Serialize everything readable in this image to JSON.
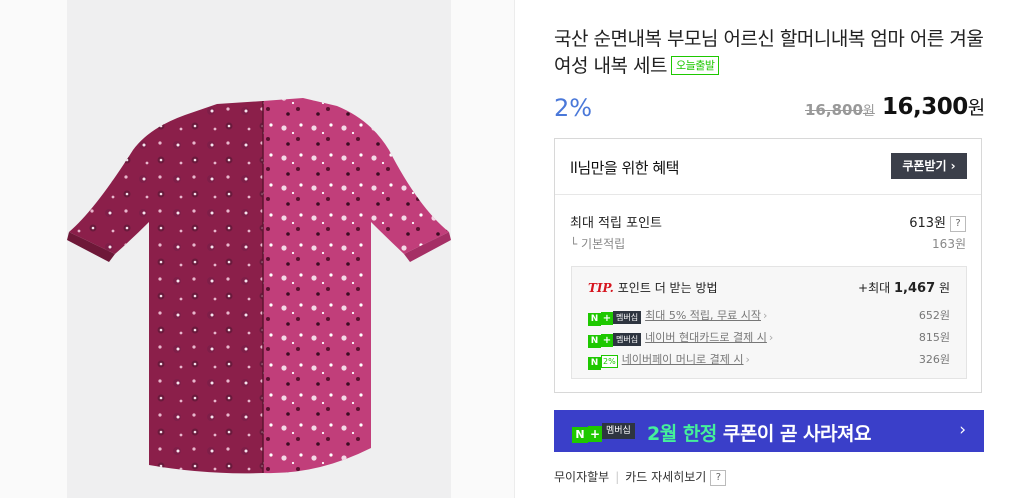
{
  "product": {
    "title": "국산 순면내복 부모님 어르신 할머니내복 엄마 어른 겨울 여성 내복 세트",
    "badge": "오늘출발",
    "discount": "2%",
    "original_price": "16,800",
    "original_unit": "원",
    "price": "16,300",
    "price_unit": "원"
  },
  "benefit": {
    "title": "ll님만을 위한 혜택",
    "coupon_button": "쿠폰받기 ›",
    "max_points_label": "최대 적립 포인트",
    "max_points_value": "613원",
    "help": "?",
    "base_label": "└ 기본적립",
    "base_value": "163원"
  },
  "tip": {
    "prefix": "TIP.",
    "title": "포인트 더 받는 방법",
    "total_prefix": "+최대",
    "total_value": "1,467",
    "total_unit": "원",
    "items": [
      {
        "pill_n": "N",
        "pill_plus": "+",
        "pill_ms": "멤버십",
        "label": "최대 5% 적립, 무료 시작",
        "chevron": "›",
        "value": "652원"
      },
      {
        "pill_n": "N",
        "pill_plus": "+",
        "pill_ms": "멤버십",
        "label": "네이버 현대카드로 결제 시",
        "chevron": "›",
        "value": "815원"
      },
      {
        "pill_n": "N",
        "pill_pct": "2%",
        "label": "네이버페이 머니로 결제 시",
        "chevron": "›",
        "value": "326원"
      }
    ]
  },
  "banner": {
    "pill_n": "N",
    "pill_plus": "+",
    "pill_ms": "멤버십",
    "highlight": "2월 한정",
    "text": " 쿠폰이 곧 사라져요",
    "arrow": "›"
  },
  "footer": {
    "installment": "무이자할부",
    "card_detail": "카드 자세히보기",
    "help": "?"
  },
  "colors": {
    "accent_discount": "#4a78d9",
    "naver_green": "#1ec800",
    "banner_bg": "#3a3fc9",
    "banner_highlight": "#45f09a",
    "tip_red": "#d6141e"
  }
}
